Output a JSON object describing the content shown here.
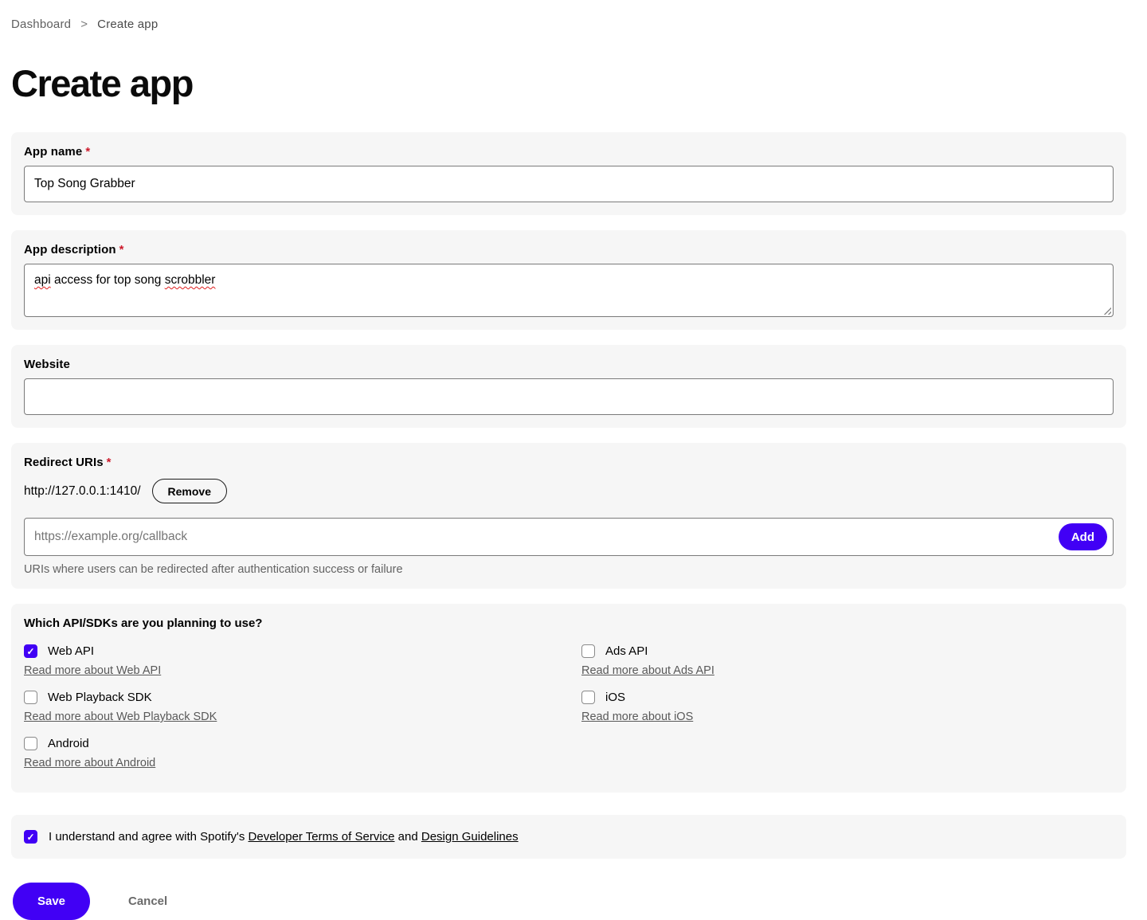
{
  "breadcrumb": {
    "items": [
      {
        "label": "Dashboard"
      },
      {
        "label": "Create app"
      }
    ]
  },
  "icons": {
    "breadcrumb_chevron": ">",
    "checkmark": "✓"
  },
  "page": {
    "title": "Create app"
  },
  "colors": {
    "accent_purple": "#4100f5",
    "panel_background": "#f6f6f6",
    "required_red": "#cd1a2b",
    "muted_text": "#636363"
  },
  "form": {
    "app_name": {
      "label": "App name",
      "required_marker": "*",
      "value": "Top Song Grabber"
    },
    "app_description": {
      "label": "App description",
      "required_marker": "*",
      "value": "api access for top song scrobbler",
      "value_parts": {
        "misspelled_1": "api",
        "middle": " access for top song ",
        "misspelled_2": "scrobbler"
      }
    },
    "website": {
      "label": "Website",
      "value": ""
    },
    "redirect_uris": {
      "label": "Redirect URIs",
      "required_marker": "*",
      "uris": [
        {
          "value": "http://127.0.0.1:1410/",
          "remove_label": "Remove"
        }
      ],
      "input_placeholder": "https://example.org/callback",
      "add_label": "Add",
      "helper": "URIs where users can be redirected after authentication success or failure"
    },
    "api_sdks": {
      "heading": "Which API/SDKs are you planning to use?",
      "options": [
        {
          "label": "Web API",
          "checked": true,
          "link": "Read more about Web API"
        },
        {
          "label": "Web Playback SDK",
          "checked": false,
          "link": "Read more about Web Playback SDK"
        },
        {
          "label": "Android",
          "checked": false,
          "link": "Read more about Android"
        },
        {
          "label": "Ads API",
          "checked": false,
          "link": "Read more about Ads API"
        },
        {
          "label": "iOS",
          "checked": false,
          "link": "Read more about iOS"
        }
      ]
    },
    "terms": {
      "checked": true,
      "text_before": "I understand and agree with Spotify's ",
      "link_terms": "Developer Terms of Service",
      "text_middle": " and ",
      "link_guidelines": "Design Guidelines"
    }
  },
  "actions": {
    "save_label": "Save",
    "cancel_label": "Cancel"
  }
}
